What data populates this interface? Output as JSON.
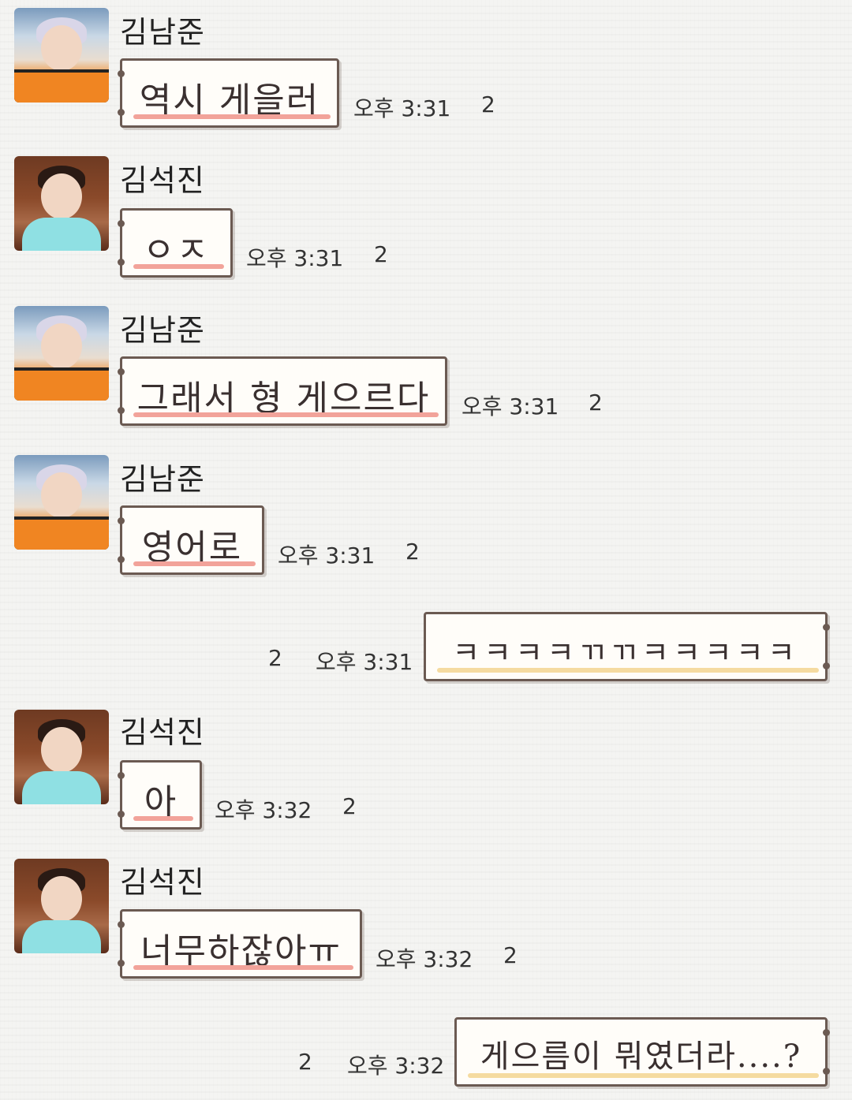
{
  "messages": [
    {
      "sender": "김남준",
      "text": "역시 게을러",
      "time": "오후 3:31",
      "unread": "2"
    },
    {
      "sender": "김석진",
      "text": "ㅇㅈ",
      "time": "오후 3:31",
      "unread": "2"
    },
    {
      "sender": "김남준",
      "text": "그래서 형 게으르다",
      "time": "오후 3:31",
      "unread": "2"
    },
    {
      "sender": "김남준",
      "text": "영어로",
      "time": "오후 3:31",
      "unread": "2"
    },
    {
      "sender": "me",
      "text": "ㅋㅋㅋㅋㄲㄲㅋㅋㅋㅋㅋ",
      "time": "오후 3:31",
      "unread": "2"
    },
    {
      "sender": "김석진",
      "text": "아",
      "time": "오후 3:32",
      "unread": "2"
    },
    {
      "sender": "김석진",
      "text": "너무하잖아ㅠ",
      "time": "오후 3:32",
      "unread": "2"
    },
    {
      "sender": "me",
      "text": "게으름이 뭐였더라....?",
      "time": "오후 3:32",
      "unread": "2"
    }
  ],
  "colors": {
    "incoming_underline": "#f2a39a",
    "outgoing_underline": "#f5dba0",
    "bubble_border": "#6b5a52"
  }
}
